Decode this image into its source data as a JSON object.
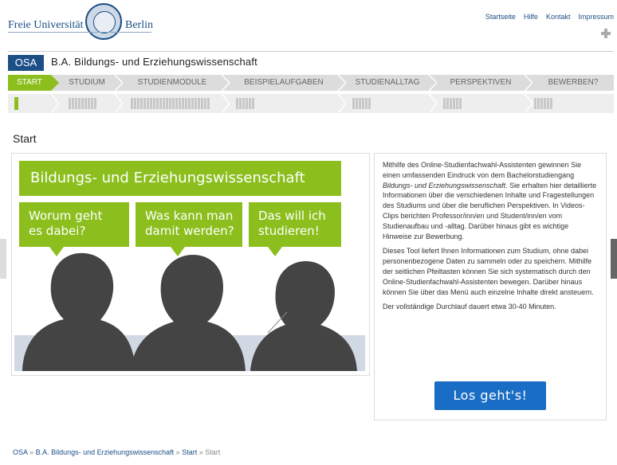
{
  "header": {
    "logo_left": "Freie Universität",
    "logo_right": "Berlin",
    "links": [
      "Startseite",
      "Hilfe",
      "Kontakt",
      "Impressum"
    ]
  },
  "program": {
    "badge": "OSA",
    "title": "B.A. Bildungs- und Erziehungswissenschaft"
  },
  "nav": {
    "tabs": [
      "START",
      "STUDIUM",
      "STUDIENMODULE",
      "BEISPIELAUFGABEN",
      "STUDIENALLTAG",
      "PERSPEKTIVEN",
      "BEWERBEN?"
    ],
    "active_index": 0
  },
  "page": {
    "title": "Start"
  },
  "hero": {
    "banner": "Bildungs- und Erziehungswissenschaft",
    "bubbles": [
      {
        "line1": "Worum geht",
        "line2": "es dabei?"
      },
      {
        "line1": "Was kann man",
        "line2": "damit werden?"
      },
      {
        "line1": "Das will ich",
        "line2": "studieren!"
      }
    ]
  },
  "info": {
    "p1_a": "Mithilfe des Online-Studienfachwahl-Assistenten gewinnen Sie einen umfassenden Eindruck von dem Bachelorstudiengang ",
    "p1_em": "Bildungs- und Erziehungswissenschaft",
    "p1_b": ". Sie erhalten hier detaillierte Informationen über die verschiedenen Inhalte und Fragestellungen des Studiums und über die beruflichen Perspektiven. In Videos-Clips berichten Professor/inn/en und Student/inn/en vom Studienaufbau und -alltag. Darüber hinaus gibt es wichtige Hinweise zur Bewerbung.",
    "p2": "Dieses Tool liefert Ihnen Informationen zum Studium, ohne dabei personenbezogene Daten zu sammeln oder zu speichern. Mithilfe der seitlichen Pfeiltasten können Sie sich systematisch durch den Online-Studienfachwahl-Assistenten bewegen. Darüber hinaus können Sie über das Menü auch einzelne Inhalte direkt ansteuern.",
    "p3": "Der vollständige Durchlauf dauert etwa 30-40 Minuten.",
    "button": "Los geht's!"
  },
  "breadcrumb": {
    "items": [
      "OSA",
      "B.A. Bildungs- und Erziehungswissenschaft",
      "Start"
    ],
    "current": "Start",
    "sep": "»"
  },
  "colors": {
    "green": "#8cbf1e",
    "blue": "#1c4f86",
    "button": "#1a6dc4"
  }
}
